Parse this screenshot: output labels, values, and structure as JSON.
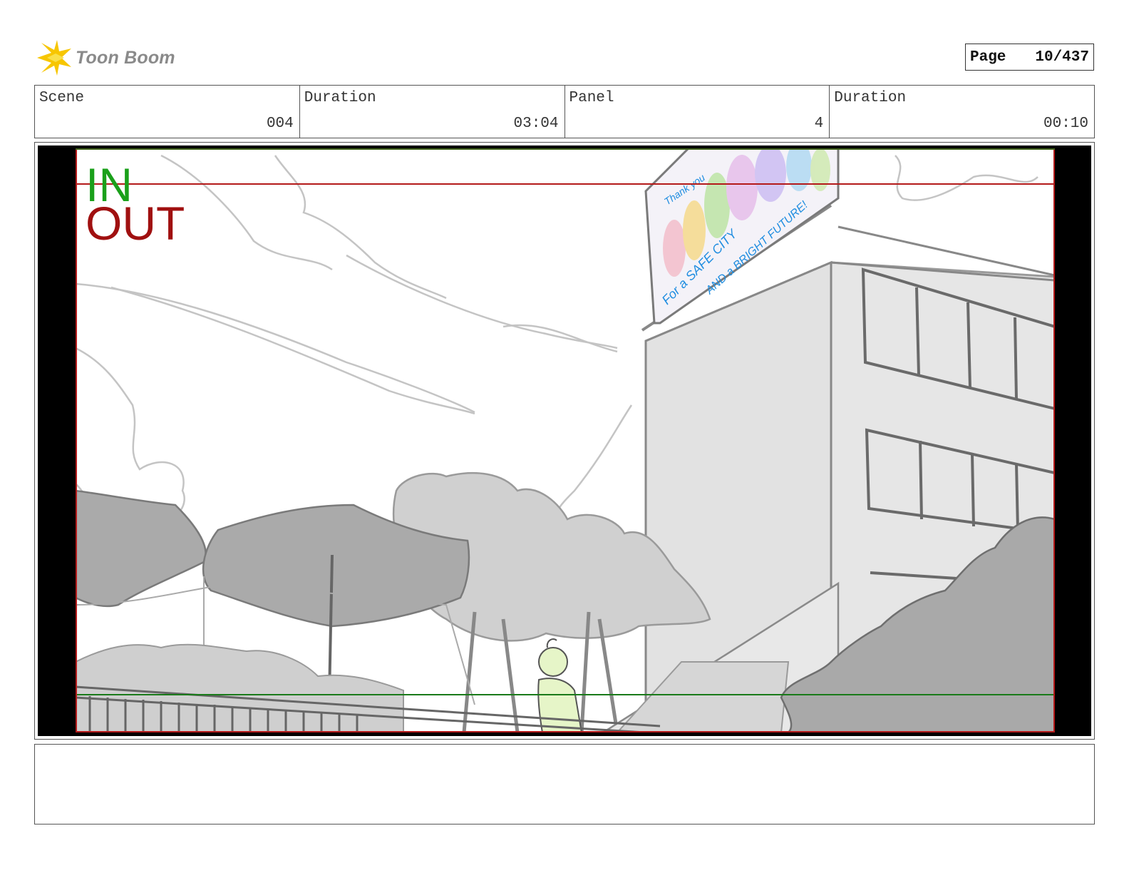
{
  "brand": {
    "name": "Toon Boom",
    "logo_icon": "toon-boom-star-icon",
    "logo_color": "#f7c600"
  },
  "page": {
    "label": "Page",
    "value": "10/437"
  },
  "info": [
    {
      "label": "Scene",
      "value": "004"
    },
    {
      "label": "Duration",
      "value": "03:04"
    },
    {
      "label": "Panel",
      "value": "4"
    },
    {
      "label": "Duration",
      "value": "00:10"
    }
  ],
  "panel": {
    "in_label": "IN",
    "out_label": "OUT",
    "in_color": "#1aa01a",
    "out_color": "#a01010",
    "billboard_text": [
      "Thank you",
      "For a SAFE CITY",
      "AND a BRIGHT FUTURE!"
    ]
  },
  "notes": {
    "text": ""
  }
}
